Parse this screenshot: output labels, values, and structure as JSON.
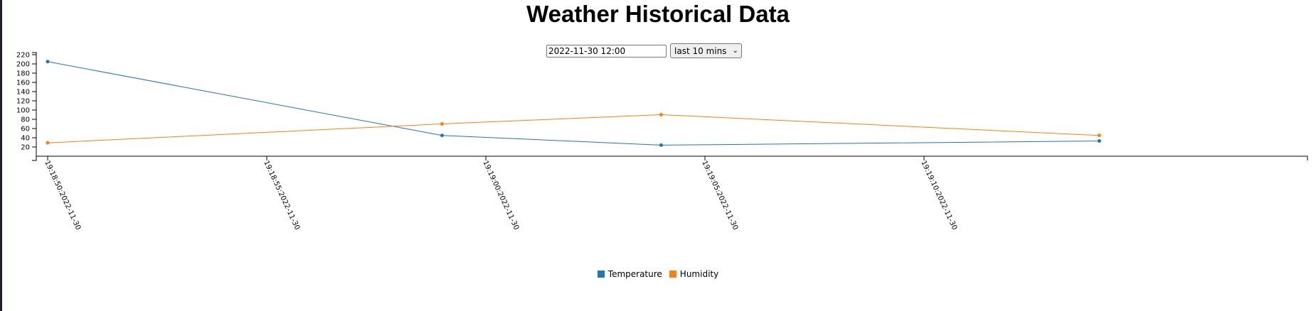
{
  "page": {
    "title": "Weather Historical Data"
  },
  "controls": {
    "date_value": "2022-11-30 12:00",
    "range_value": "last 10 mins",
    "chevron_icon": "chevron-down-icon"
  },
  "chart_data": {
    "type": "line",
    "title": "",
    "xlabel": "",
    "ylabel": "",
    "ylim": [
      0,
      220
    ],
    "y_ticks": [
      20,
      40,
      60,
      80,
      100,
      120,
      140,
      160,
      180,
      200,
      220
    ],
    "x_ticks": [
      "19:18:50:2022-11-30",
      "19:18:55:2022-11-30",
      "19:19:00:2022-11-30",
      "19:19:05:2022-11-30",
      "19:19:10:2022-11-30"
    ],
    "xlim": [
      "19:18:50",
      "19:19:14"
    ],
    "grid": false,
    "legend": "bottom-center",
    "series": [
      {
        "name": "Temperature",
        "color": "#1f77b4",
        "points": [
          {
            "x": "19:18:50",
            "y": 205
          },
          {
            "x": "19:18:59",
            "y": 45
          },
          {
            "x": "19:19:04",
            "y": 24
          },
          {
            "x": "19:19:14",
            "y": 33
          }
        ]
      },
      {
        "name": "Humidity",
        "color": "#ff7f0e",
        "points": [
          {
            "x": "19:18:50",
            "y": 29
          },
          {
            "x": "19:18:59",
            "y": 70
          },
          {
            "x": "19:19:04",
            "y": 90
          },
          {
            "x": "19:19:14",
            "y": 45
          }
        ]
      }
    ]
  }
}
